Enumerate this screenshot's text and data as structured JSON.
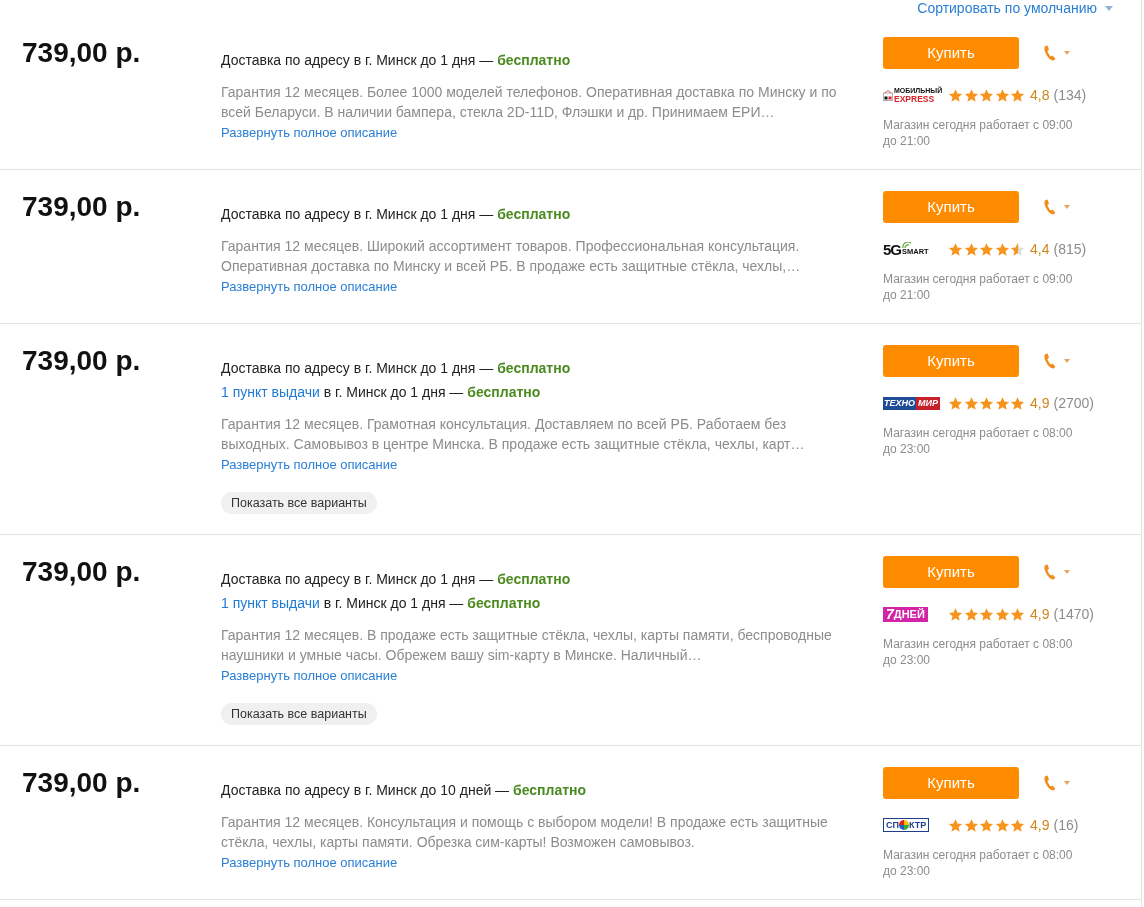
{
  "sort": {
    "label": "Сортировать по умолчанию"
  },
  "offers": [
    {
      "price": "739,00 р.",
      "delivery": [
        {
          "kind": "address",
          "text": "Доставка по адресу в г. Минск до 1 дня —",
          "cost": "бесплатно"
        }
      ],
      "description": "Гарантия 12 месяцев. Более 1000 моделей телефонов. Оперативная доставка по Минску и по всей Беларуси. В наличии бампера, стекла 2D-11D, Флэшки и др. Принимаем ЕРИ…",
      "expand_link": "Развернуть полное описание",
      "buy_button": "Купить",
      "store": {
        "logo": {
          "kind": "express",
          "parts": [
            "МОБИЛЬНЫЙ",
            "EXPRESS"
          ]
        },
        "stars": 5,
        "rating": "4,8",
        "reviews": "(134)",
        "hours": "Магазин сегодня работает с 09:00 до 21:00"
      }
    },
    {
      "price": "739,00 р.",
      "delivery": [
        {
          "kind": "address",
          "text": "Доставка по адресу в г. Минск до 1 дня —",
          "cost": "бесплатно"
        }
      ],
      "description": "Гарантия 12 месяцев. Широкий ассортимент товаров. Профессиональная консультация. Оперативная доставка по Минску и всей РБ. В продаже есть защитные стёкла, чехлы,…",
      "expand_link": "Развернуть полное описание",
      "buy_button": "Купить",
      "store": {
        "logo": {
          "kind": "smart",
          "parts": [
            "5G",
            "SMART"
          ]
        },
        "stars": 4.5,
        "rating": "4,4",
        "reviews": "(815)",
        "hours": "Магазин сегодня работает с 09:00 до 21:00"
      }
    },
    {
      "price": "739,00 р.",
      "delivery": [
        {
          "kind": "address",
          "text": "Доставка по адресу в г. Минск до 1 дня —",
          "cost": "бесплатно"
        },
        {
          "kind": "pickup",
          "link": "1 пункт выдачи",
          "text": "в г. Минск до 1 дня —",
          "cost": "бесплатно"
        }
      ],
      "description": "Гарантия 12 месяцев. Грамотная консультация. Доставляем по всей РБ. Работаем без выходных. Самовывоз в центре Минска. В продаже есть защитные стёкла, чехлы, карт…",
      "expand_link": "Развернуть полное описание",
      "variants_button": "Показать все варианты",
      "buy_button": "Купить",
      "store": {
        "logo": {
          "kind": "tekhnomir",
          "parts": [
            "ТЕХНО",
            "МИР"
          ]
        },
        "stars": 5,
        "rating": "4,9",
        "reviews": "(2700)",
        "hours": "Магазин сегодня работает с 08:00 до 23:00"
      }
    },
    {
      "price": "739,00 р.",
      "delivery": [
        {
          "kind": "address",
          "text": "Доставка по адресу в г. Минск до 1 дня —",
          "cost": "бесплатно"
        },
        {
          "kind": "pickup",
          "link": "1 пункт выдачи",
          "text": "в г. Минск до 1 дня —",
          "cost": "бесплатно"
        }
      ],
      "description": "Гарантия 12 месяцев. В продаже есть защитные стёкла, чехлы, карты памяти, беспроводные наушники и умные часы. Обрежем вашу sim-карту в Минске. Наличный…",
      "expand_link": "Развернуть полное описание",
      "variants_button": "Показать все варианты",
      "buy_button": "Купить",
      "store": {
        "logo": {
          "kind": "dney",
          "parts": [
            "7",
            "ДНЕЙ"
          ]
        },
        "stars": 5,
        "rating": "4,9",
        "reviews": "(1470)",
        "hours": "Магазин сегодня работает с 08:00 до 23:00"
      }
    },
    {
      "price": "739,00 р.",
      "delivery": [
        {
          "kind": "address",
          "text": "Доставка по адресу в г. Минск до 10 дней —",
          "cost": "бесплатно"
        }
      ],
      "description": "Гарантия 12 месяцев. Консультация и помощь с выбором модели! В продаже есть защитные стёкла, чехлы, карты памяти. Обрезка сим-карты! Возможен самовывоз.",
      "expand_link": "Развернуть полное описание",
      "buy_button": "Купить",
      "store": {
        "logo": {
          "kind": "spektr",
          "parts": [
            "СП",
            "КТР"
          ]
        },
        "stars": 5,
        "rating": "4,9",
        "reviews": "(16)",
        "hours": "Магазин сегодня работает с 08:00 до 23:00"
      }
    }
  ]
}
